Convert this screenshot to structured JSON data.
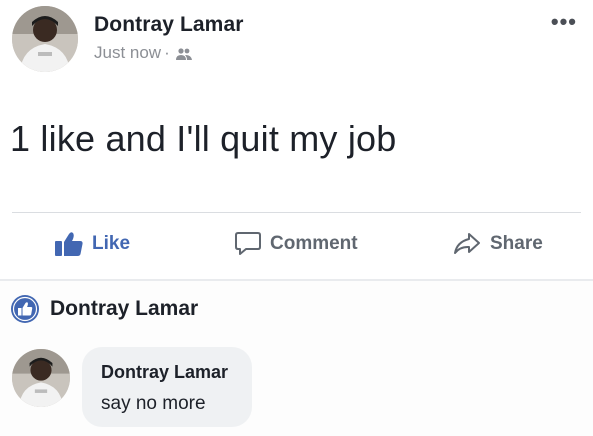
{
  "post": {
    "author": "Dontray Lamar",
    "timestamp": "Just now",
    "separator": "·",
    "privacy_icon": "friends-icon",
    "more_label": "•••",
    "text": "1 like and I'll quit my job"
  },
  "actions": {
    "like_label": "Like",
    "comment_label": "Comment",
    "share_label": "Share"
  },
  "reactions": {
    "liker_name": "Dontray Lamar"
  },
  "comment": {
    "author": "Dontray Lamar",
    "text": "say no more"
  },
  "colors": {
    "facebook_blue": "#4267b2",
    "action_gray": "#606770",
    "meta_gray": "#8c8f95",
    "bubble_gray": "#eff1f3"
  }
}
